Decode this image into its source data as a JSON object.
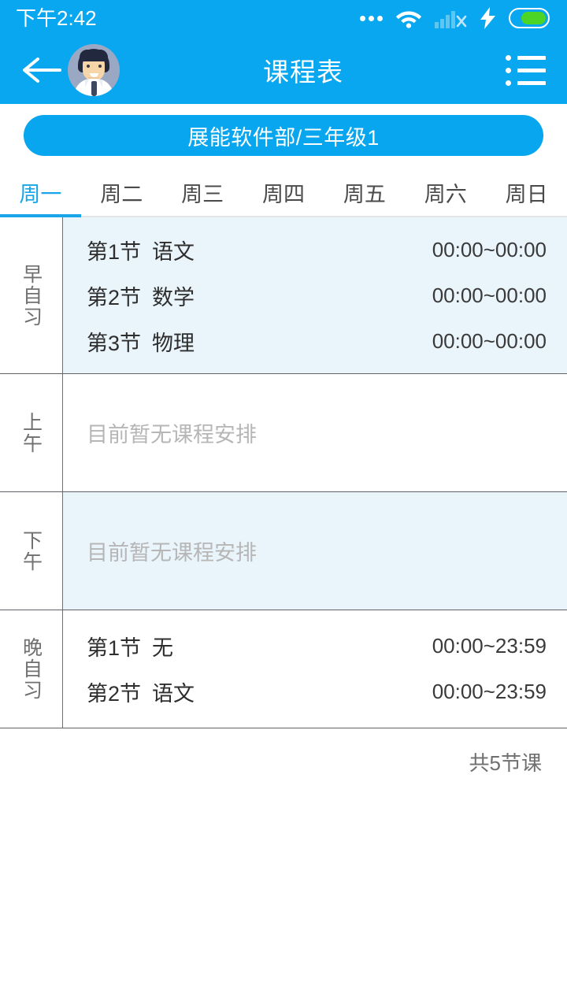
{
  "status_bar": {
    "time": "下午2:42",
    "icons": [
      "more-dots-icon",
      "wifi-icon",
      "signal-no-sim-icon",
      "charging-bolt-icon",
      "battery-icon"
    ],
    "battery_level_percent": 74
  },
  "header": {
    "back_icon": "back-arrow-icon",
    "avatar_icon": "user-avatar-icon",
    "title": "课程表",
    "menu_icon": "list-menu-icon"
  },
  "class_selector": {
    "label": "展能软件部/三年级1"
  },
  "tabs": {
    "active_index": 0,
    "items": [
      {
        "label": "周一"
      },
      {
        "label": "周二"
      },
      {
        "label": "周三"
      },
      {
        "label": "周四"
      },
      {
        "label": "周五"
      },
      {
        "label": "周六"
      },
      {
        "label": "周日"
      }
    ]
  },
  "schedule": {
    "empty_text": "目前暂无课程安排",
    "rows": [
      {
        "period_label": "早自习",
        "tinted": true,
        "lessons": [
          {
            "index": "第1节",
            "subject": "语文",
            "time": "00:00~00:00"
          },
          {
            "index": "第2节",
            "subject": "数学",
            "time": "00:00~00:00"
          },
          {
            "index": "第3节",
            "subject": "物理",
            "time": "00:00~00:00"
          }
        ]
      },
      {
        "period_label": "上午",
        "tinted": false,
        "lessons": []
      },
      {
        "period_label": "下午",
        "tinted": true,
        "lessons": []
      },
      {
        "period_label": "晚自习",
        "tinted": false,
        "lessons": [
          {
            "index": "第1节",
            "subject": "无",
            "time": "00:00~23:59"
          },
          {
            "index": "第2节",
            "subject": "语文",
            "time": "00:00~23:59"
          }
        ]
      }
    ]
  },
  "footer": {
    "total_label": "共5节课"
  },
  "colors": {
    "header_blue": "#09A7EF",
    "accent_blue": "#18A6E8",
    "pill_blue": "#07A6EE",
    "row_tint": "#E9F4FB",
    "battery_green": "#4CD427",
    "divider": "#5F6368"
  }
}
